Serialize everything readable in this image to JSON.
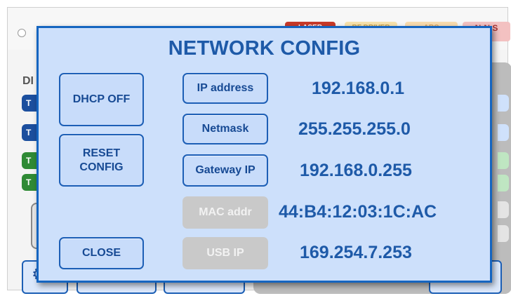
{
  "background": {
    "tags": [
      "LASER",
      "RF DRIVER",
      "ARC",
      "N-N S"
    ],
    "side_label": "DI",
    "pills": [
      "T",
      "T",
      "T",
      "T"
    ]
  },
  "modal": {
    "title": "NETWORK CONFIG",
    "buttons": {
      "dhcp": "DHCP OFF",
      "reset": "RESET CONFIG",
      "close": "CLOSE"
    },
    "fields": [
      {
        "label": "IP address",
        "value": "192.168.0.1",
        "enabled": true
      },
      {
        "label": "Netmask",
        "value": "255.255.255.0",
        "enabled": true
      },
      {
        "label": "Gateway IP",
        "value": "192.168.0.255",
        "enabled": true
      },
      {
        "label": "MAC addr",
        "value": "44:B4:12:03:1C:AC",
        "enabled": false
      },
      {
        "label": "USB IP",
        "value": "169.254.7.253",
        "enabled": false
      }
    ]
  },
  "colors": {
    "modal_bg": "#cde0fb",
    "accent": "#1565c0",
    "text": "#1e5aa8",
    "disabled": "#c9c9c9"
  }
}
